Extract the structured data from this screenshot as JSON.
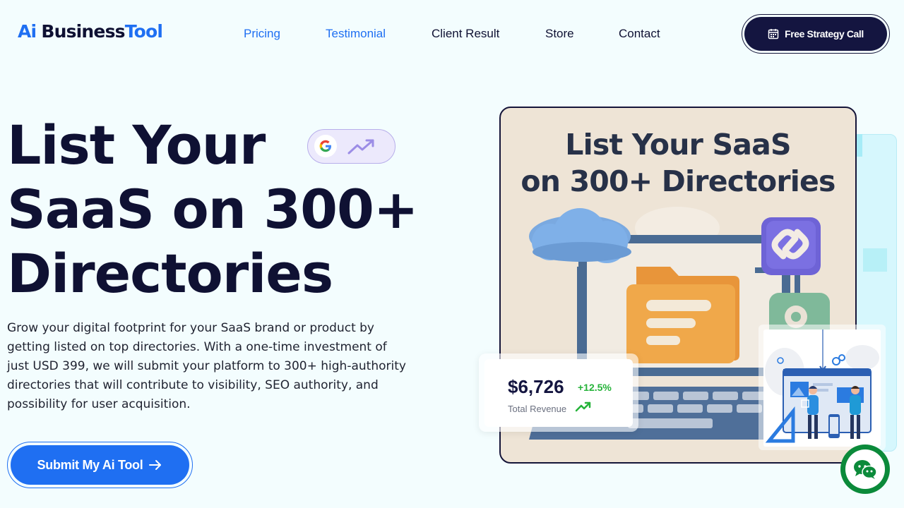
{
  "header": {
    "logo": {
      "part1": "Ai",
      "part2": "Business",
      "part3": "Tool"
    },
    "nav": [
      {
        "label": "Pricing",
        "state": "active"
      },
      {
        "label": "Testimonial",
        "state": "active"
      },
      {
        "label": "Client Result",
        "state": "default"
      },
      {
        "label": "Store",
        "state": "default"
      },
      {
        "label": "Contact",
        "state": "default"
      }
    ],
    "cta": {
      "label": "Free Strategy Call",
      "icon": "calendar-icon"
    }
  },
  "hero": {
    "title_lines": [
      "List Your",
      "SaaS on 300+",
      "Directories"
    ],
    "badge": {
      "icons": [
        "google-logo-icon",
        "trend-up-icon"
      ]
    },
    "description": "Grow your digital footprint for your SaaS brand or product by getting listed on top directories. With a one-time investment of just USD 399, we will submit your platform to 300+ high-authority directories that will contribute to visibility, SEO authority, and possibility for user acquisition.",
    "submit": {
      "label": "Submit My Ai Tool",
      "icon": "arrow-right-icon"
    }
  },
  "hero_image": {
    "title_lines": [
      "List Your SaaS",
      "on 300+ Directories"
    ],
    "icons": [
      "cloud-icon",
      "folder-icon",
      "link-icon",
      "location-pin-icon",
      "laptop-keyboard"
    ]
  },
  "revenue_card": {
    "amount": "$6,726",
    "change": "+12.5%",
    "label": "Total Revenue",
    "icon": "trend-up-icon"
  },
  "chat_widget": {
    "icon": "wechat-icon"
  },
  "colors": {
    "background": "#f3fdfe",
    "primary": "#1f6ff2",
    "navy": "#141540",
    "positive": "#26b33a",
    "chat_green": "#0b8a3a"
  }
}
